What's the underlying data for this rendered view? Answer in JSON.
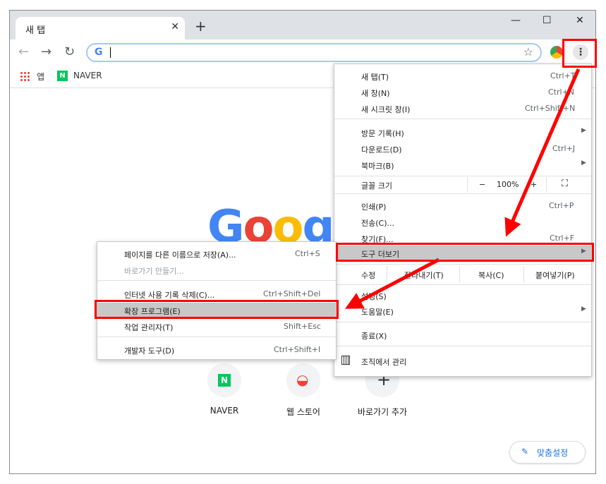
{
  "browser": {
    "tab_title": "새 탭",
    "tab_close": "✕",
    "new_tab": "+",
    "window_controls": [
      "—",
      "☐",
      "✕"
    ],
    "nav": {
      "back": "←",
      "forward": "→",
      "reload": "↻"
    },
    "omnibox_icon": "G",
    "star_icon": "☆",
    "menu_icon": "⋮",
    "bookmarks": [
      {
        "label": "앱",
        "icon": "apps-grid-icon"
      },
      {
        "label": "NAVER",
        "icon": "naver-icon"
      }
    ],
    "naver_letter": "N"
  },
  "ntp": {
    "logo_letters": [
      "G",
      "o",
      "o",
      "g"
    ],
    "logo_colors": [
      "#4285f4",
      "#ea4335",
      "#fbbc05",
      "#4285f4"
    ],
    "tiles": [
      {
        "label": "NAVER",
        "glyph": "N"
      },
      {
        "label": "웹 스토어",
        "glyph": "◒"
      },
      {
        "label": "바로가기 추가",
        "glyph": "+"
      }
    ],
    "customize": {
      "icon": "✎",
      "label": "맞춤설정"
    }
  },
  "main_menu": {
    "items": [
      {
        "label": "새 탭(T)",
        "shortcut": "Ctrl+T"
      },
      {
        "label": "새 창(N)",
        "shortcut": "Ctrl+N"
      },
      {
        "label": "새 시크릿 창(I)",
        "shortcut": "Ctrl+Shift+N"
      },
      {
        "label": "방문 기록(H)",
        "shortcut": "",
        "arrow": "▶"
      },
      {
        "label": "다운로드(D)",
        "shortcut": "Ctrl+J"
      },
      {
        "label": "북마크(B)",
        "shortcut": "",
        "arrow": "▶"
      }
    ],
    "zoom": {
      "label": "글꼴 크기",
      "minus": "−",
      "value": "100%",
      "plus": "+",
      "fullscreen": "⛶"
    },
    "items2": [
      {
        "label": "인쇄(P)",
        "shortcut": "Ctrl+P"
      },
      {
        "label": "전송(C)...",
        "shortcut": ""
      },
      {
        "label": "찾기(F)...",
        "shortcut": "Ctrl+F"
      },
      {
        "label": "도구 더보기",
        "shortcut": "",
        "arrow": "▶"
      }
    ],
    "edit": {
      "label": "수정",
      "cut": "잘라내기(T)",
      "copy": "복사(C)",
      "paste": "붙여넣기(P)"
    },
    "items3": [
      {
        "label": "설정(S)",
        "shortcut": ""
      },
      {
        "label": "도움말(E)",
        "shortcut": "",
        "arrow": "▶"
      },
      {
        "label": "종료(X)",
        "shortcut": ""
      }
    ],
    "managed": {
      "icon": "building-icon",
      "label": "조직에서 관리"
    }
  },
  "sub_menu": {
    "items": [
      {
        "label": "페이지를 다른 이름으로 저장(A)...",
        "shortcut": "Ctrl+S"
      },
      {
        "label": "바로가기 만들기...",
        "shortcut": ""
      },
      {
        "label": "인터넷 사용 기록 삭제(C)...",
        "shortcut": "Ctrl+Shift+Del"
      },
      {
        "label": "확장 프로그램(E)",
        "shortcut": ""
      },
      {
        "label": "작업 관리자(T)",
        "shortcut": "Shift+Esc"
      },
      {
        "label": "개발자 도구(D)",
        "shortcut": "Ctrl+Shift+I"
      }
    ]
  },
  "colors": {
    "highlight": "#ff0000",
    "menu_hover": "#c8c8c8"
  }
}
